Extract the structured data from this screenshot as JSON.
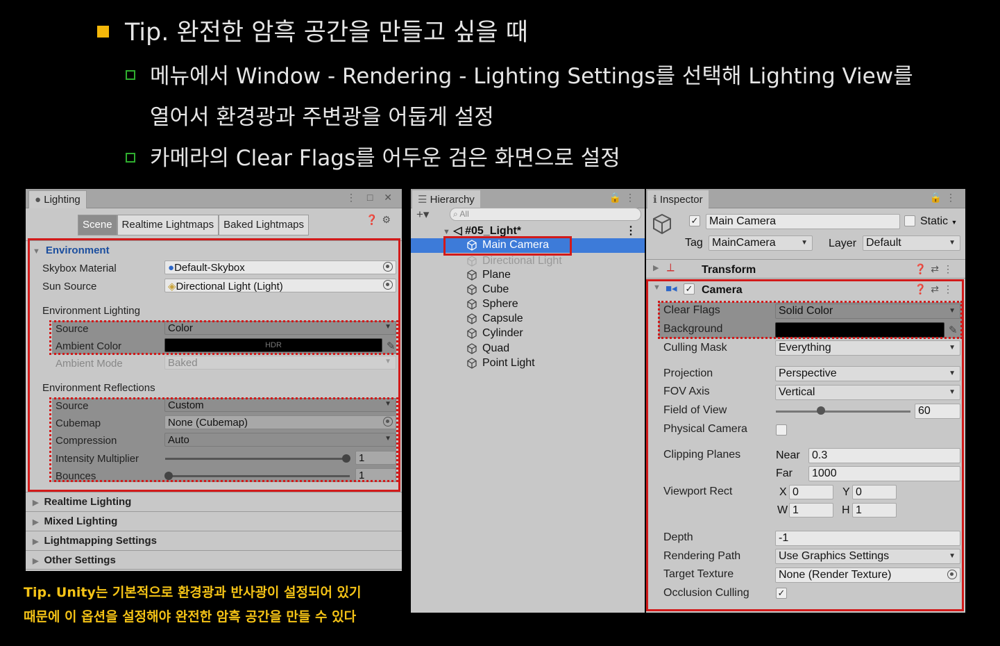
{
  "slide": {
    "title": "Tip. 완전한 암흑 공간을 만들고 싶을 때",
    "bullet1_line1": "메뉴에서 Window - Rendering - Lighting Settings를 선택해 Lighting View를",
    "bullet1_line2": "열어서 환경광과 주변광을 어둡게 설정",
    "bullet2": "카메라의 Clear Flags를 어두운 검은 화면으로 설정",
    "tip_line1": "Tip. Unity는 기본적으로 환경광과 반사광이 설정되어 있기",
    "tip_line2": "때문에 이 옵션을 설정해야 완전한 암흑 공간을 만들 수 있다"
  },
  "lighting": {
    "tab": "Lighting",
    "subtabs": [
      "Scene",
      "Realtime Lightmaps",
      "Baked Lightmaps"
    ],
    "environment": "Environment",
    "skybox_label": "Skybox Material",
    "skybox_value": "Default-Skybox",
    "sun_label": "Sun Source",
    "sun_value": "Directional Light (Light)",
    "env_lighting": "Environment Lighting",
    "source_label": "Source",
    "source_value": "Color",
    "ambient_color_label": "Ambient Color",
    "ambient_color_hdr": "HDR",
    "ambient_mode_label": "Ambient Mode",
    "ambient_mode_value": "Baked",
    "env_reflections": "Environment Reflections",
    "refl_source_label": "Source",
    "refl_source_value": "Custom",
    "cubemap_label": "Cubemap",
    "cubemap_value": "None (Cubemap)",
    "compression_label": "Compression",
    "compression_value": "Auto",
    "intensity_label": "Intensity Multiplier",
    "intensity_value": "1",
    "bounces_label": "Bounces",
    "bounces_value": "1",
    "folds": [
      "Realtime Lighting",
      "Mixed Lighting",
      "Lightmapping Settings",
      "Other Settings"
    ]
  },
  "hierarchy": {
    "tab": "Hierarchy",
    "search_placeholder": "All",
    "scene": "#05_Light*",
    "items": [
      "Main Camera",
      "Directional Light",
      "Plane",
      "Cube",
      "Sphere",
      "Capsule",
      "Cylinder",
      "Quad",
      "Point Light"
    ]
  },
  "inspector": {
    "tab": "Inspector",
    "object_name": "Main Camera",
    "static_label": "Static",
    "tag_label": "Tag",
    "tag_value": "MainCamera",
    "layer_label": "Layer",
    "layer_value": "Default",
    "transform": "Transform",
    "camera": "Camera",
    "clear_flags_label": "Clear Flags",
    "clear_flags_value": "Solid Color",
    "background_label": "Background",
    "culling_label": "Culling Mask",
    "culling_value": "Everything",
    "projection_label": "Projection",
    "projection_value": "Perspective",
    "fov_axis_label": "FOV Axis",
    "fov_axis_value": "Vertical",
    "fov_label": "Field of View",
    "fov_value": "60",
    "physical_label": "Physical Camera",
    "clipping_label": "Clipping Planes",
    "near_label": "Near",
    "near_value": "0.3",
    "far_label": "Far",
    "far_value": "1000",
    "viewport_label": "Viewport Rect",
    "x_label": "X",
    "x_value": "0",
    "y_label": "Y",
    "y_value": "0",
    "w_label": "W",
    "w_value": "1",
    "h_label": "H",
    "h_value": "1",
    "depth_label": "Depth",
    "depth_value": "-1",
    "render_path_label": "Rendering Path",
    "render_path_value": "Use Graphics Settings",
    "target_label": "Target Texture",
    "target_value": "None (Render Texture)",
    "occlusion_label": "Occlusion Culling"
  },
  "colors": {
    "accent_red": "#d21a1a",
    "selection_blue": "#3d7bd9",
    "tip_yellow": "#f5c316",
    "bullet_orange": "#f5b80a",
    "bullet_green": "#2fae2f"
  }
}
